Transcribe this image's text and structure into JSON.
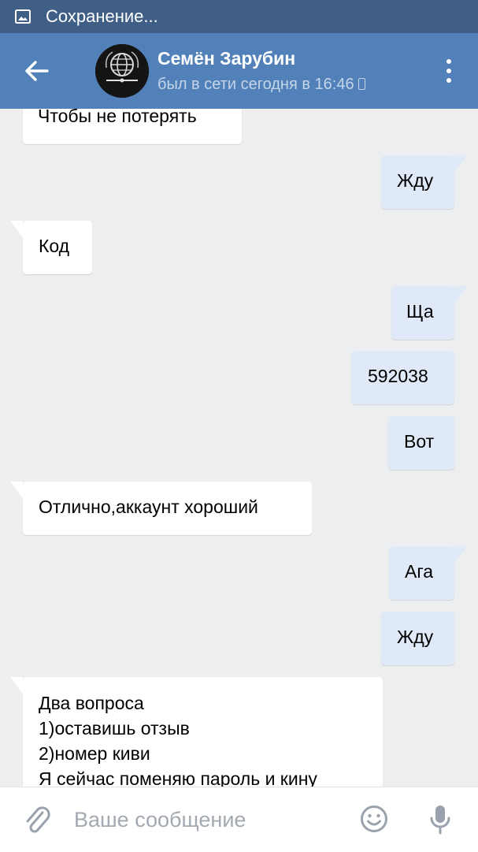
{
  "status_bar": {
    "text": "Сохранение...",
    "icon": "image-icon"
  },
  "header": {
    "back_icon": "arrow-left-icon",
    "contact_name": "Семён Зарубин",
    "contact_status": "был в сети сегодня в 16:46",
    "device_icon": "phone-icon",
    "more_icon": "more-vertical-icon"
  },
  "messages": [
    {
      "direction": "in",
      "text": "Чтобы не потерять"
    },
    {
      "direction": "out",
      "text": "Жду"
    },
    {
      "direction": "in",
      "text": "Код"
    },
    {
      "direction": "out",
      "text": "Ща"
    },
    {
      "direction": "out",
      "text": "592038"
    },
    {
      "direction": "out",
      "text": "Вот"
    },
    {
      "direction": "in",
      "text": "Отлично,аккаунт хороший"
    },
    {
      "direction": "out",
      "text": "Ага"
    },
    {
      "direction": "out",
      "text": "Жду"
    },
    {
      "direction": "in",
      "lines": [
        "Два вопроса",
        "1)оставишь отзыв",
        "2)номер киви",
        "Я сейчас поменяю пароль и кину"
      ]
    }
  ],
  "composer": {
    "placeholder": "Ваше сообщение",
    "attach_icon": "paperclip-icon",
    "emoji_icon": "smiley-icon",
    "mic_icon": "microphone-icon"
  },
  "colors": {
    "status_bar": "#3f5f86",
    "header": "#5181b8",
    "chat_background": "#edeef0",
    "incoming_bubble": "#ffffff",
    "outgoing_bubble": "#dfe9f7"
  }
}
